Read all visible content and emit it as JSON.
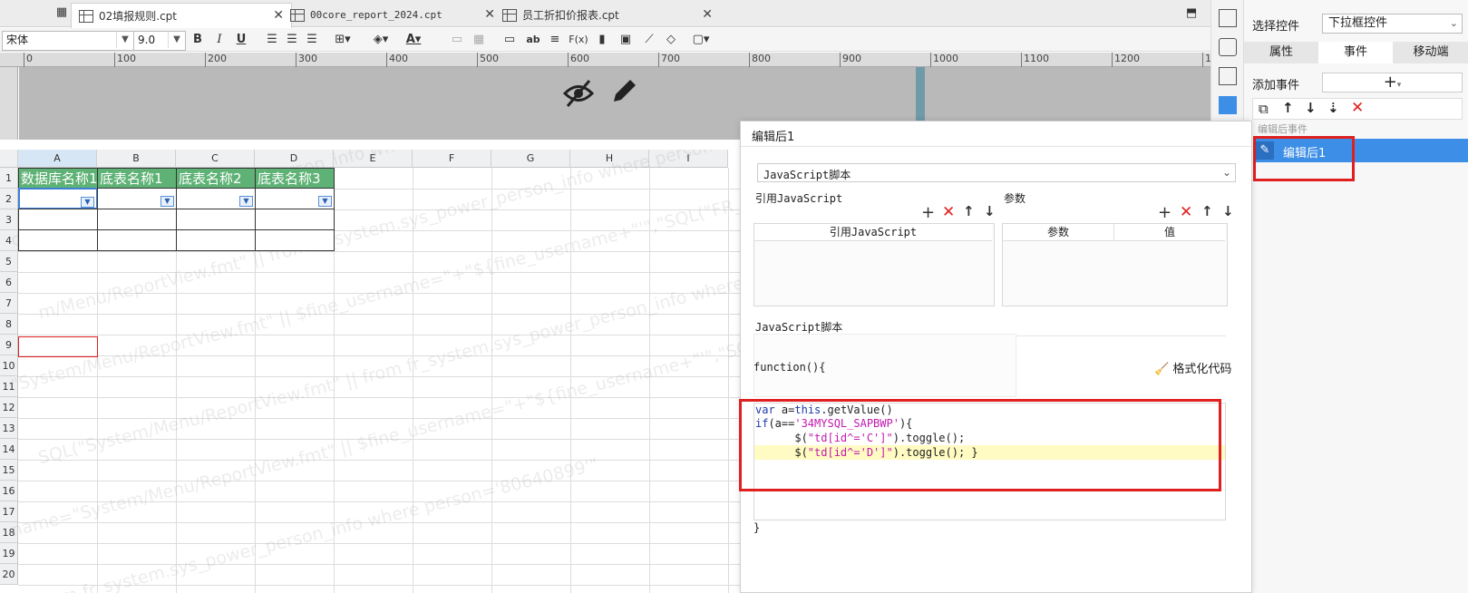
{
  "tabs": [
    {
      "label": "02填报规则.cpt",
      "active": true
    },
    {
      "label": "00core_report_2024.cpt",
      "active": false
    },
    {
      "label": "员工折扣价报表.cpt",
      "active": false
    }
  ],
  "toolbar": {
    "font_family": "宋体",
    "font_size": "9.0",
    "bold": "B",
    "italic": "I",
    "underline": "U",
    "fx": "F(x)",
    "ab": "ab"
  },
  "ruler": [
    "0",
    "100",
    "200",
    "300",
    "400",
    "500",
    "600",
    "700",
    "800",
    "900",
    "1000",
    "1100",
    "1200",
    "1"
  ],
  "grid": {
    "columns": [
      "A",
      "B",
      "C",
      "D",
      "E",
      "F",
      "G",
      "H",
      "I"
    ],
    "rows": [
      "1",
      "2",
      "3",
      "4",
      "5",
      "6",
      "7",
      "8",
      "9",
      "10",
      "11",
      "12",
      "13",
      "14",
      "15",
      "16",
      "17",
      "18",
      "19",
      "20"
    ],
    "header_cells": [
      "数据库名称1",
      "底表名称1",
      "底表名称2",
      "底表名称3"
    ],
    "watermark_lines": [
      "ow from fr_system.sys_power_person_info where person='80640899'\"; $fine_username",
      "m/Menu/ReportView.fmt\" || from fr_system.sys_power_person_info where person='80640899'\" SQL(\"FR_SYSTEM\", \"select concat",
      "\"System/Menu/ReportView.fmt\" || $fine_username=\"+\"${fine_username+\"'\",\"SQL(\"FR_SYSTEM\",\"select",
      "SQL(\"System/Menu/ReportView.fmt\" || from fr_system.sys_power_person_info where person='80640899'\",",
      "name=\"System/Menu/ReportView.fmt\" || $fine_username=\"+\"${fine_username+\"'\",\"SQL(\"FR_SYSTEM\",",
      "from fr_system.sys_power_person_info where person='80640899'\""
    ]
  },
  "right_panel": {
    "select_label": "选择控件",
    "select_value": "下拉框控件",
    "tabs": [
      "属性",
      "事件",
      "移动端"
    ],
    "active_tab": "事件",
    "add_event_label": "添加事件",
    "add_symbol": "+",
    "event_group_label": "编辑后事件",
    "event_item": "编辑后1"
  },
  "dialog": {
    "title": "编辑后1",
    "type_value": "JavaScript脚本",
    "ref_js_label": "引用JavaScript",
    "params_label": "参数",
    "ref_js_col": "引用JavaScript",
    "params_col": "参数",
    "value_col": "值",
    "js_script_label": "JavaScript脚本",
    "function_header": "function(){",
    "format_code": "格式化代码",
    "closing_brace": "}",
    "code": {
      "l1_kw": "var",
      "l1_a": " a=",
      "l1_this": "this",
      "l1_rest": ".getValue()",
      "l2_if": "if",
      "l2_cond": "(a==",
      "l2_str": "'34MYSQL_SAPBWP'",
      "l2_end": "){",
      "l3_pre": "      $(",
      "l3_str": "\"td[id^='C']\"",
      "l3_end": ").toggle();",
      "l4_pre": "      $(",
      "l4_str": "\"td[id^='D']\"",
      "l4_end": ").toggle(); }"
    }
  },
  "colors": {
    "header_green": "#5fb276",
    "highlight_red": "#e02020",
    "selected_blue": "#3d8ee6",
    "highlight_line": "#fffbc2"
  }
}
